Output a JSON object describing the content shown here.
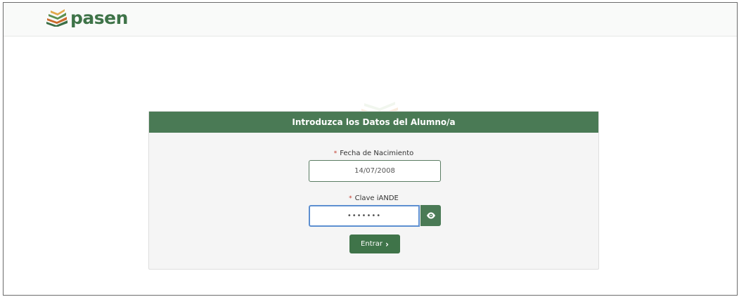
{
  "brand": {
    "name": "pasen",
    "color": "#3e7348"
  },
  "form": {
    "title": "Introduzca los Datos del Alumno/a",
    "header_color": "#4a7a55",
    "birthdate": {
      "label": "Fecha de Nacimiento",
      "required_mark": "*",
      "value": "14/07/2008"
    },
    "password": {
      "label": "Clave iANDE",
      "required_mark": "*",
      "value": "•••••••",
      "toggle_icon": "eye-icon"
    },
    "submit": {
      "label": "Entrar",
      "icon": "chevron-right-icon"
    }
  }
}
